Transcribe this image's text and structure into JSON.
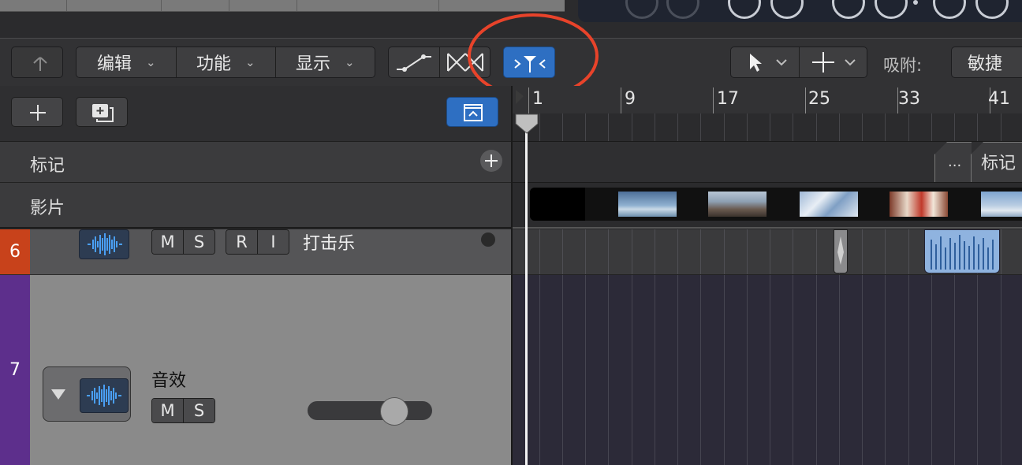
{
  "toolbar": {
    "menus": [
      {
        "label": "编辑"
      },
      {
        "label": "功能"
      },
      {
        "label": "显示"
      }
    ],
    "snap_label": "吸附:",
    "snap_value": "敏捷"
  },
  "track_list": {
    "marker_label": "标记",
    "movie_label": "影片"
  },
  "tracks": [
    {
      "number": "6",
      "name": "打击乐",
      "color": "#c8421b",
      "buttons": [
        "M",
        "S",
        "R",
        "I"
      ]
    },
    {
      "number": "7",
      "name": "音效",
      "color": "#5d2f8c",
      "buttons": [
        "M",
        "S"
      ]
    }
  ],
  "ruler": {
    "bars": [
      "1",
      "9",
      "17",
      "25",
      "33",
      "41"
    ]
  },
  "timeline": {
    "marker_ellipsis": "...",
    "marker_label": "标记"
  },
  "annotation": {
    "color": "#e8432a"
  },
  "accent": "#2e6fc2"
}
